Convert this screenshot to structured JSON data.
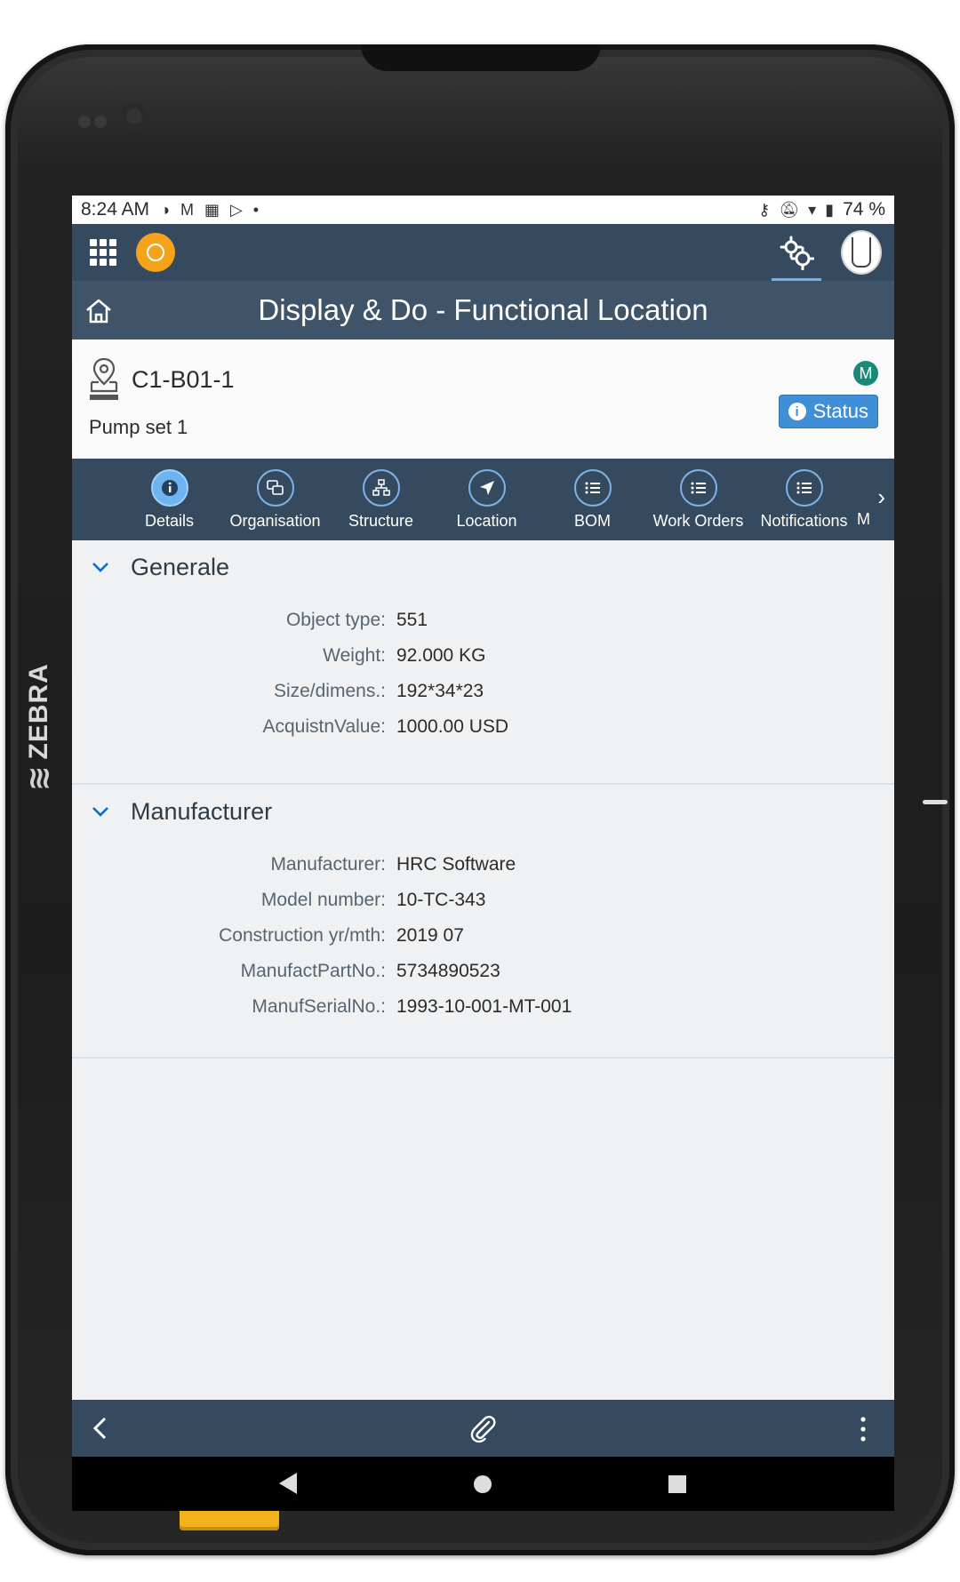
{
  "status_bar": {
    "time": "8:24 AM",
    "left_icons": [
      "sync-icon",
      "gmail-icon",
      "calendar-icon",
      "play-store-icon",
      "dot-icon"
    ],
    "right_icons": [
      "key-icon",
      "mute-icon",
      "wifi-icon",
      "battery-icon"
    ],
    "battery": "74 %"
  },
  "shell": {
    "menu_icon": "app-grid-icon",
    "logo_icon": "orange-circle-logo",
    "settings_icon": "gears-icon",
    "avatar_icon": "user-avatar"
  },
  "titlebar": {
    "home_icon": "home-icon",
    "title": "Display & Do - Functional Location"
  },
  "object": {
    "id": "C1-B01-1",
    "description": "Pump set 1",
    "badge": "M",
    "status_label": "Status",
    "badge_color": "#1a8a78",
    "status_color": "#3f8ed6"
  },
  "tabs": [
    {
      "label": "Details",
      "icon": "info-icon"
    },
    {
      "label": "Organisation",
      "icon": "organisation-icon"
    },
    {
      "label": "Structure",
      "icon": "hierarchy-icon"
    },
    {
      "label": "Location",
      "icon": "navigation-arrow-icon"
    },
    {
      "label": "BOM",
      "icon": "list-icon"
    },
    {
      "label": "Work Orders",
      "icon": "list-icon"
    },
    {
      "label": "Notifications",
      "icon": "list-icon"
    }
  ],
  "tab_overflow_text": "M",
  "sections": {
    "general": {
      "title": "Generale",
      "fields": [
        {
          "label": "Object type:",
          "value": "551"
        },
        {
          "label": "Weight:",
          "value": "92.000 KG"
        },
        {
          "label": "Size/dimens.:",
          "value": "192*34*23"
        },
        {
          "label": "AcquistnValue:",
          "value": "1000.00 USD"
        }
      ]
    },
    "manufacturer": {
      "title": "Manufacturer",
      "fields": [
        {
          "label": "Manufacturer:",
          "value": "HRC Software"
        },
        {
          "label": "Model number:",
          "value": "10-TC-343"
        },
        {
          "label": "Construction yr/mth:",
          "value": "2019 07"
        },
        {
          "label": "ManufactPartNo.:",
          "value": "5734890523"
        },
        {
          "label": "ManufSerialNo.:",
          "value": "1993-10-001-MT-001"
        }
      ]
    }
  },
  "footer": {
    "back_icon": "chevron-left-icon",
    "attach_icon": "paperclip-icon",
    "more_icon": "more-vertical-icon"
  },
  "android_nav": [
    "back-triangle",
    "home-circle",
    "recents-square"
  ],
  "device": {
    "brand": "ZEBRA"
  },
  "colors": {
    "shell": "#354a5f",
    "title": "#3f5468",
    "content_bg": "#eff1f3"
  }
}
